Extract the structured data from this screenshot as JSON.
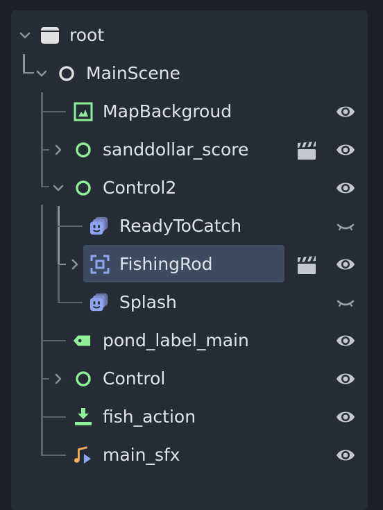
{
  "tree": {
    "nodes": [
      {
        "name": "root",
        "icon": "window-node-icon",
        "expanded": true,
        "visible": null,
        "has_scene": false,
        "selected": false
      },
      {
        "name": "MainScene",
        "icon": "node-circle-icon",
        "expanded": true,
        "visible": null,
        "has_scene": false,
        "selected": false
      },
      {
        "name": "MapBackgroud",
        "icon": "texture-rect-icon",
        "expanded": null,
        "visible": true,
        "has_scene": false,
        "selected": false
      },
      {
        "name": "sanddollar_score",
        "icon": "control-circle-icon",
        "expanded": false,
        "visible": true,
        "has_scene": true,
        "selected": false
      },
      {
        "name": "Control2",
        "icon": "control-circle-icon",
        "expanded": true,
        "visible": true,
        "has_scene": false,
        "selected": false
      },
      {
        "name": "ReadyToCatch",
        "icon": "animated-sprite-icon",
        "expanded": null,
        "visible": false,
        "has_scene": false,
        "selected": false
      },
      {
        "name": "FishingRod",
        "icon": "reference-rect-icon",
        "expanded": false,
        "visible": true,
        "has_scene": true,
        "selected": true
      },
      {
        "name": "Splash",
        "icon": "animated-sprite-icon",
        "expanded": null,
        "visible": false,
        "has_scene": false,
        "selected": false
      },
      {
        "name": "pond_label_main",
        "icon": "label-tag-icon",
        "expanded": null,
        "visible": true,
        "has_scene": false,
        "selected": false
      },
      {
        "name": "Control",
        "icon": "control-circle-icon",
        "expanded": false,
        "visible": true,
        "has_scene": false,
        "selected": false
      },
      {
        "name": "fish_action",
        "icon": "download-action-icon",
        "expanded": null,
        "visible": true,
        "has_scene": false,
        "selected": false
      },
      {
        "name": "main_sfx",
        "icon": "audio-note-icon",
        "expanded": null,
        "visible": true,
        "has_scene": false,
        "selected": false
      }
    ]
  },
  "colors": {
    "background": "#1c2129",
    "panel": "#262c36",
    "selection": "#3c4b5f",
    "text": "#dfe3ea",
    "control_green": "#8eef97",
    "sprite_blue": "#8da5f3",
    "icon_gray": "#c3c7cf"
  }
}
